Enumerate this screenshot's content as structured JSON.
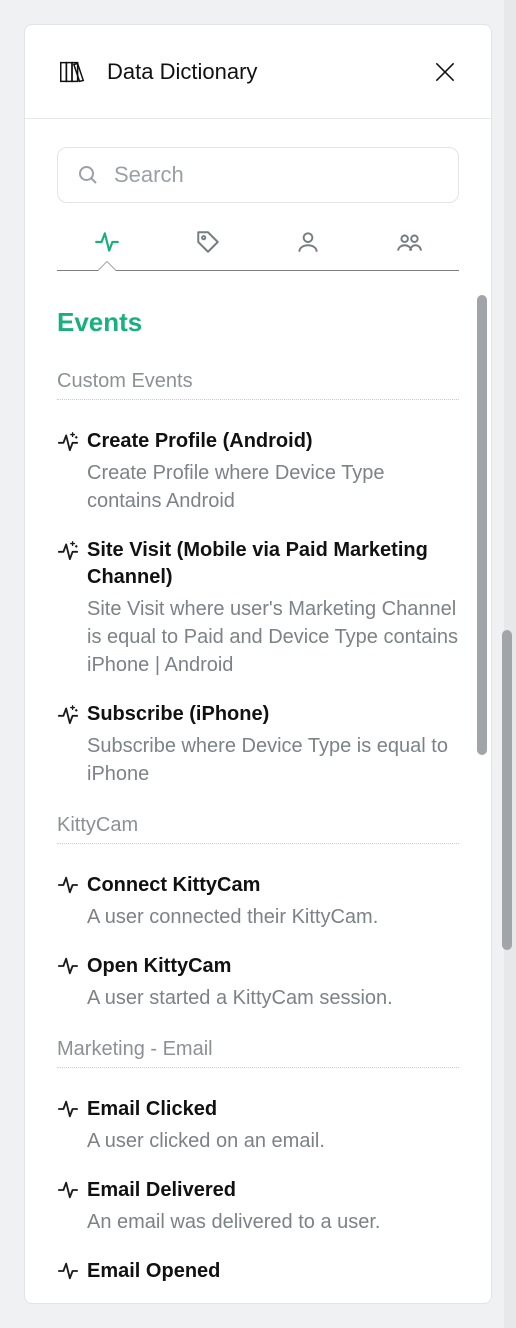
{
  "header": {
    "title": "Data Dictionary"
  },
  "search": {
    "placeholder": "Search",
    "value": ""
  },
  "tabs": {
    "active_index": 0,
    "items": [
      {
        "id": "events",
        "icon": "activity"
      },
      {
        "id": "tags",
        "icon": "tag"
      },
      {
        "id": "user",
        "icon": "user"
      },
      {
        "id": "group",
        "icon": "users"
      }
    ]
  },
  "content": {
    "title": "Events",
    "groups": [
      {
        "label": "Custom Events",
        "items": [
          {
            "icon": "sparkle-activity",
            "name": "Create Profile (Android)",
            "desc": "Create Profile where Device Type contains Android"
          },
          {
            "icon": "sparkle-activity",
            "name": "Site Visit (Mobile via Paid Marketing Channel)",
            "desc": "Site Visit where user's Marketing Channel is equal to Paid and Device Type contains iPhone | Android"
          },
          {
            "icon": "sparkle-activity",
            "name": "Subscribe (iPhone)",
            "desc": "Subscribe where Device Type is equal to iPhone"
          }
        ]
      },
      {
        "label": "KittyCam",
        "items": [
          {
            "icon": "activity",
            "name": "Connect KittyCam",
            "desc": "A user connected their KittyCam."
          },
          {
            "icon": "activity",
            "name": "Open KittyCam",
            "desc": "A user started a KittyCam session."
          }
        ]
      },
      {
        "label": "Marketing - Email",
        "items": [
          {
            "icon": "activity",
            "name": "Email Clicked",
            "desc": "A user clicked on an email."
          },
          {
            "icon": "activity",
            "name": "Email Delivered",
            "desc": "An email was delivered to a user."
          },
          {
            "icon": "activity",
            "name": "Email Opened",
            "desc": ""
          }
        ]
      }
    ]
  },
  "colors": {
    "accent": "#18b07c",
    "muted": "#8c9196"
  }
}
